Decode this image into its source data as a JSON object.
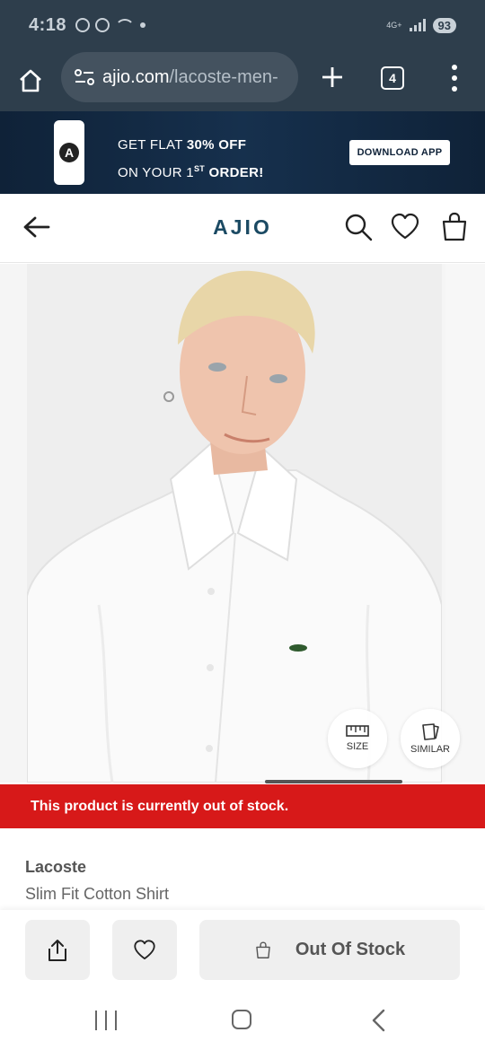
{
  "status_bar": {
    "time": "4:18",
    "network_label": "4G+",
    "battery": "93",
    "icons": [
      "whatsapp-icon",
      "whatsapp-icon",
      "wifi-call-icon",
      "dot-icon",
      "signal-icon",
      "battery-icon"
    ]
  },
  "browser": {
    "url_domain": "ajio.com",
    "url_path": "/lacoste-men-",
    "tab_count": "4"
  },
  "promo": {
    "line1_prefix": "GET FLAT ",
    "line1_bold": "30% OFF",
    "line2_prefix": "ON YOUR 1",
    "line2_sup": "ST",
    "line2_bold": " ORDER!",
    "download_label": "DOWNLOAD APP",
    "app_logo_letter": "A"
  },
  "header": {
    "brand": "AJIO"
  },
  "product_image": {
    "size_label": "SIZE",
    "similar_label": "SIMILAR"
  },
  "stock_notice": "This product is currently out of stock.",
  "product": {
    "brand": "Lacoste",
    "name": "Slim Fit Cotton Shirt"
  },
  "actions": {
    "out_of_stock_label": "Out Of Stock"
  },
  "colors": {
    "status_bg": "#2e3e4c",
    "brand_teal": "#1b4a63",
    "alert_red": "#d71919"
  }
}
